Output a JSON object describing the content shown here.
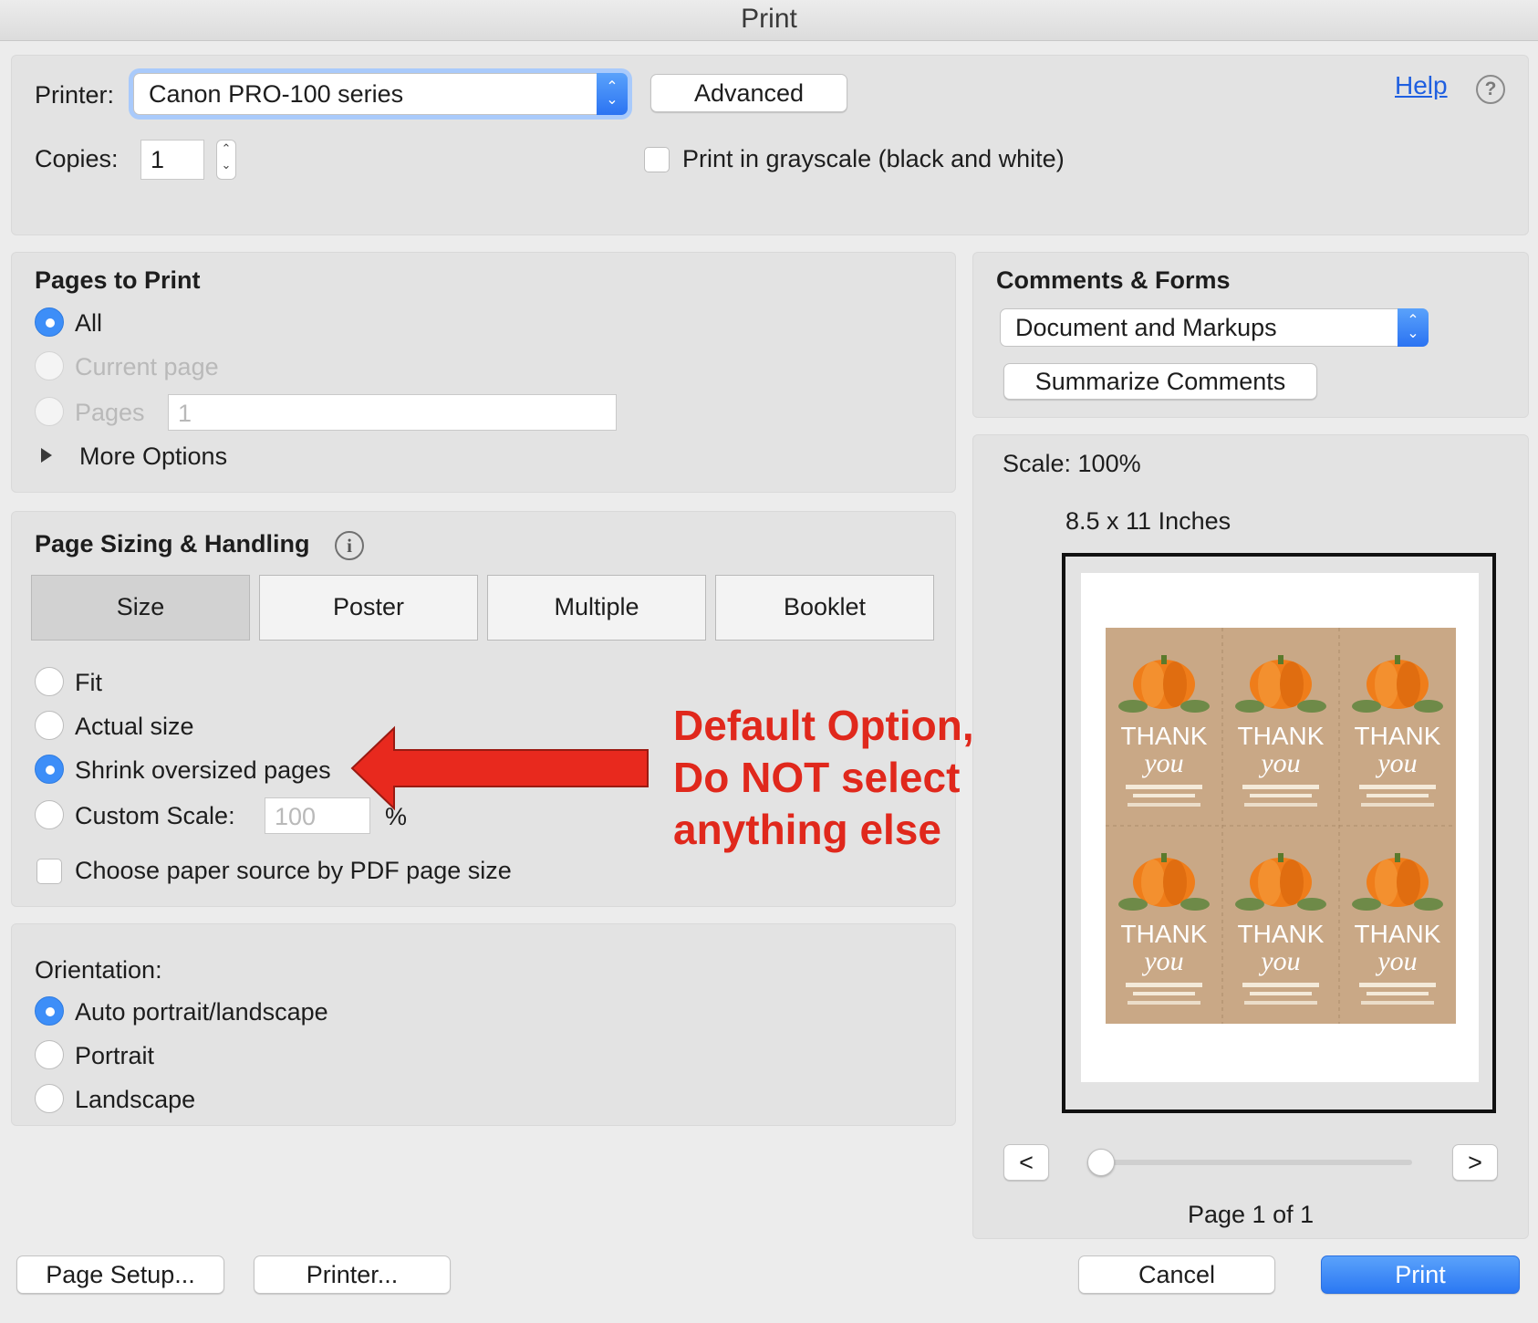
{
  "window": {
    "title": "Print"
  },
  "printer": {
    "label": "Printer:",
    "selected": "Canon PRO-100 series",
    "advanced_label": "Advanced",
    "help_label": "Help",
    "copies_label": "Copies:",
    "copies_value": "1",
    "grayscale_label": "Print in grayscale (black and white)",
    "grayscale_checked": false
  },
  "pages_to_print": {
    "title": "Pages to Print",
    "options": [
      {
        "label": "All",
        "selected": true,
        "enabled": true
      },
      {
        "label": "Current page",
        "selected": false,
        "enabled": false
      },
      {
        "label": "Pages",
        "selected": false,
        "enabled": false
      }
    ],
    "pages_value": "1",
    "more_options_label": "More Options"
  },
  "page_sizing": {
    "title": "Page Sizing & Handling",
    "tabs": [
      "Size",
      "Poster",
      "Multiple",
      "Booklet"
    ],
    "active_tab": "Size",
    "options": [
      {
        "label": "Fit",
        "selected": false
      },
      {
        "label": "Actual size",
        "selected": false
      },
      {
        "label": "Shrink oversized pages",
        "selected": true
      },
      {
        "label": "Custom Scale:",
        "selected": false
      }
    ],
    "custom_scale_value": "100",
    "custom_scale_unit": "%",
    "paper_source_label": "Choose paper source by PDF page size",
    "paper_source_checked": false
  },
  "annotation": {
    "lines": [
      "Default Option,",
      "Do NOT select",
      "anything else"
    ],
    "color": "#e0281c"
  },
  "orientation": {
    "title": "Orientation:",
    "options": [
      {
        "label": "Auto portrait/landscape",
        "selected": true
      },
      {
        "label": "Portrait",
        "selected": false
      },
      {
        "label": "Landscape",
        "selected": false
      }
    ]
  },
  "comments_forms": {
    "title": "Comments & Forms",
    "selected": "Document and Markups",
    "summarize_label": "Summarize Comments"
  },
  "preview": {
    "scale_label": "Scale: 100%",
    "paper_size": "8.5 x 11 Inches",
    "prev_label": "<",
    "next_label": ">",
    "page_indicator": "Page 1 of 1",
    "slider_fraction": 0
  },
  "footer": {
    "page_setup_label": "Page Setup...",
    "printer_label": "Printer...",
    "cancel_label": "Cancel",
    "print_label": "Print"
  },
  "colors": {
    "accent": "#3d8ef8",
    "primary_button": "#3a86f6"
  }
}
